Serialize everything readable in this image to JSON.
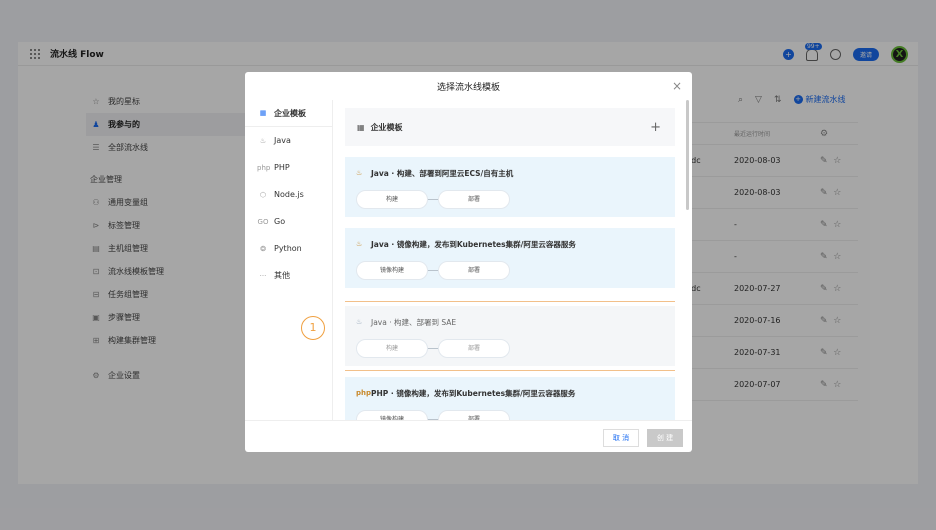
{
  "app": {
    "title": "流水线 Flow",
    "bell_badge": "99+",
    "invite_label": "邀请",
    "avatar_letter": "X"
  },
  "sidebar": {
    "items_top": [
      {
        "icon": "star-icon",
        "glyph": "☆",
        "label": "我的星标"
      },
      {
        "icon": "user-icon",
        "glyph": "♟",
        "label": "我参与的",
        "active": true
      },
      {
        "icon": "list-icon",
        "glyph": "☰",
        "label": "全部流水线"
      }
    ],
    "group_label": "企业管理",
    "items_group": [
      {
        "icon": "variable-icon",
        "glyph": "⚇",
        "label": "通用变量组"
      },
      {
        "icon": "tag-icon",
        "glyph": "⊳",
        "label": "标签管理"
      },
      {
        "icon": "host-icon",
        "glyph": "▤",
        "label": "主机组管理"
      },
      {
        "icon": "template-icon",
        "glyph": "⊡",
        "label": "流水线模板管理"
      },
      {
        "icon": "task-icon",
        "glyph": "⊟",
        "label": "任务组管理"
      },
      {
        "icon": "step-icon",
        "glyph": "▣",
        "label": "步骤管理"
      },
      {
        "icon": "cluster-icon",
        "glyph": "⊞",
        "label": "构建集群管理"
      }
    ],
    "settings": {
      "icon": "settings-icon",
      "glyph": "⚙",
      "label": "企业设置"
    }
  },
  "toolbar": {
    "new_label": "新建流水线"
  },
  "table": {
    "header_last_run": "最近运行时间",
    "rows": [
      {
        "prefix": "rdc",
        "date": "2020-08-03"
      },
      {
        "prefix": "",
        "date": "2020-08-03"
      },
      {
        "prefix": "",
        "date": "-"
      },
      {
        "prefix": "",
        "date": "-"
      },
      {
        "prefix": "rdc",
        "date": "2020-07-27"
      },
      {
        "prefix": "",
        "date": "2020-07-16"
      },
      {
        "prefix": "",
        "date": "2020-07-31"
      },
      {
        "prefix": "",
        "date": "2020-07-07"
      }
    ]
  },
  "modal": {
    "title": "选择流水线模板",
    "categories": [
      {
        "icon": "enterprise-icon",
        "glyph": "▦",
        "label": "企业模板",
        "selected": true
      },
      {
        "icon": "java-icon",
        "glyph": "♨",
        "label": "Java"
      },
      {
        "icon": "php-icon",
        "glyph": "php",
        "label": "PHP"
      },
      {
        "icon": "nodejs-icon",
        "glyph": "⬡",
        "label": "Node.js"
      },
      {
        "icon": "go-icon",
        "glyph": "GO",
        "label": "Go"
      },
      {
        "icon": "python-icon",
        "glyph": "❂",
        "label": "Python"
      },
      {
        "icon": "more-icon",
        "glyph": "···",
        "label": "其他"
      }
    ],
    "section_title": "企业模板",
    "section_add": "+",
    "templates": [
      {
        "icon": "java-icon",
        "glyph": "♨",
        "title": "Java · 构建、部署到阿里云ECS/自有主机",
        "stages": [
          "构建",
          "部署"
        ]
      },
      {
        "icon": "java-icon",
        "glyph": "♨",
        "title": "Java · 镜像构建，发布到Kubernetes集群/阿里云容器服务",
        "stages": [
          "镜像构建",
          "部署"
        ]
      },
      {
        "icon": "java-icon",
        "glyph": "♨",
        "title": "Java · 构建、部署到 SAE",
        "stages": [
          "构建",
          "部署"
        ],
        "highlighted": true
      },
      {
        "icon": "php-icon",
        "glyph": "php",
        "title": "PHP · 镜像构建，发布到Kubernetes集群/阿里云容器服务",
        "stages": [
          "镜像构建",
          "部署"
        ]
      }
    ],
    "cancel_label": "取 消",
    "create_label": "创 建",
    "step_marker": "1"
  }
}
